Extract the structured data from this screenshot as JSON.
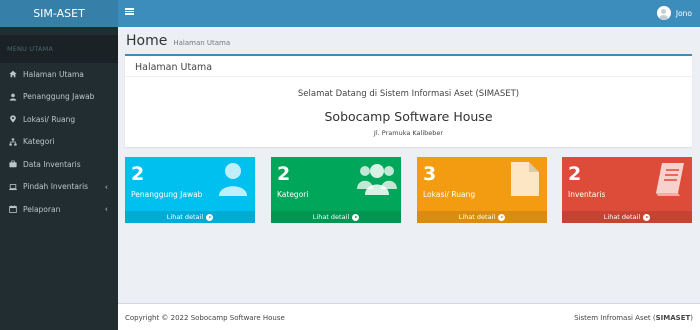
{
  "app": {
    "brand": "SIM-ASET"
  },
  "colors": {
    "sidebar": "#222d32",
    "topbar": "#3c8dbc",
    "aqua": "#00c0ef",
    "green": "#00a65a",
    "yellow": "#f39c12",
    "red": "#dd4b39"
  },
  "topbar": {
    "user_name": "Jono",
    "menu_icon": "hamburger-icon"
  },
  "sidebar": {
    "header": "MENU UTAMA",
    "items": [
      {
        "label": "Halaman Utama",
        "icon": "home-icon"
      },
      {
        "label": "Penanggung Jawab",
        "icon": "user-icon"
      },
      {
        "label": "Lokasi/ Ruang",
        "icon": "map-marker-icon"
      },
      {
        "label": "Kategori",
        "icon": "sitemap-icon"
      },
      {
        "label": "Data Inventaris",
        "icon": "briefcase-icon"
      },
      {
        "label": "Pindah Inventaris",
        "icon": "laptop-icon",
        "chevron": "‹"
      },
      {
        "label": "Pelaporan",
        "icon": "calendar-icon",
        "chevron": "‹"
      }
    ]
  },
  "page": {
    "title": "Home",
    "subtitle": "Halaman Utama"
  },
  "box": {
    "title": "Halaman Utama",
    "welcome": "Selamat Datang di Sistem Informasi Aset (SIMASET)",
    "company": "Sobocamp Software House",
    "address": "Jl. Pramuka Kalibeber"
  },
  "tiles": [
    {
      "count": "2",
      "label": "Penanggung Jawab",
      "link": "Lihat detail",
      "icon": "user-icon"
    },
    {
      "count": "2",
      "label": "Kategori",
      "link": "Lihat detail",
      "icon": "users-icon"
    },
    {
      "count": "3",
      "label": "Lokasi/ Ruang",
      "link": "Lihat detail",
      "icon": "file-icon"
    },
    {
      "count": "2",
      "label": "Inventaris",
      "link": "Lihat detail",
      "icon": "book-icon"
    }
  ],
  "footer": {
    "copyright": "Copyright © 2022 Sobocamp Software House",
    "system_prefix": "Sistem Infromasi Aset (",
    "system_short": "SIMASET",
    "system_suffix": ")"
  }
}
